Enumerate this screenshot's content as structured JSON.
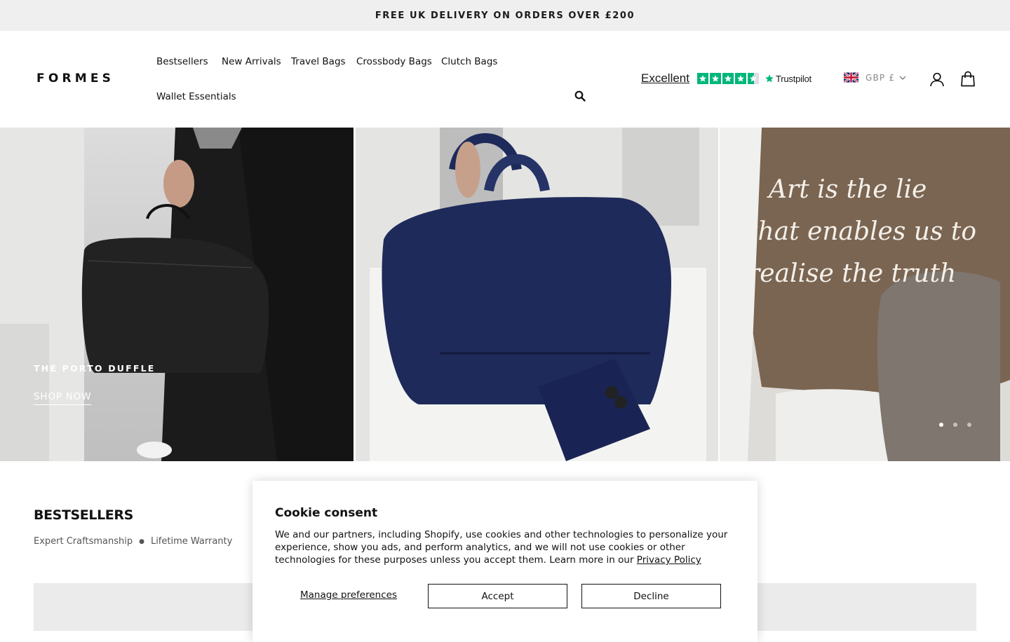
{
  "announcement": "FREE UK DELIVERY ON ORDERS OVER £200",
  "header": {
    "logo": "FORMES",
    "nav": [
      "Bestsellers",
      "New Arrivals",
      "Travel Bags",
      "Crossbody Bags",
      "Clutch Bags",
      "Wallet Essentials"
    ],
    "trustpilot": {
      "rating_text": "Excellent",
      "stars": 4.5,
      "brand": "Trustpilot"
    },
    "currency": "GBP £",
    "icons": [
      "search-icon",
      "flag-uk-icon",
      "chevron-down-icon",
      "account-icon",
      "cart-icon"
    ]
  },
  "hero": {
    "title": "THE PORTO DUFFLE",
    "cta": "SHOP NOW",
    "slides": 3,
    "active_slide": 1
  },
  "bestsellers": {
    "title": "BESTSELLERS",
    "features": [
      "Expert Craftsmanship",
      "Lifetime Warranty"
    ]
  },
  "cookie": {
    "title": "Cookie consent",
    "body": "We and our partners, including Shopify, use cookies and other technologies to personalize your experience, show you ads, and perform analytics, and we will not use cookies or other technologies for these purposes unless you accept them. Learn more in our ",
    "policy_link": "Privacy Policy",
    "manage": "Manage preferences",
    "accept": "Accept",
    "decline": "Decline"
  },
  "colors": {
    "trustpilot_green": "#00b67a",
    "announce_bg": "#efefef"
  }
}
